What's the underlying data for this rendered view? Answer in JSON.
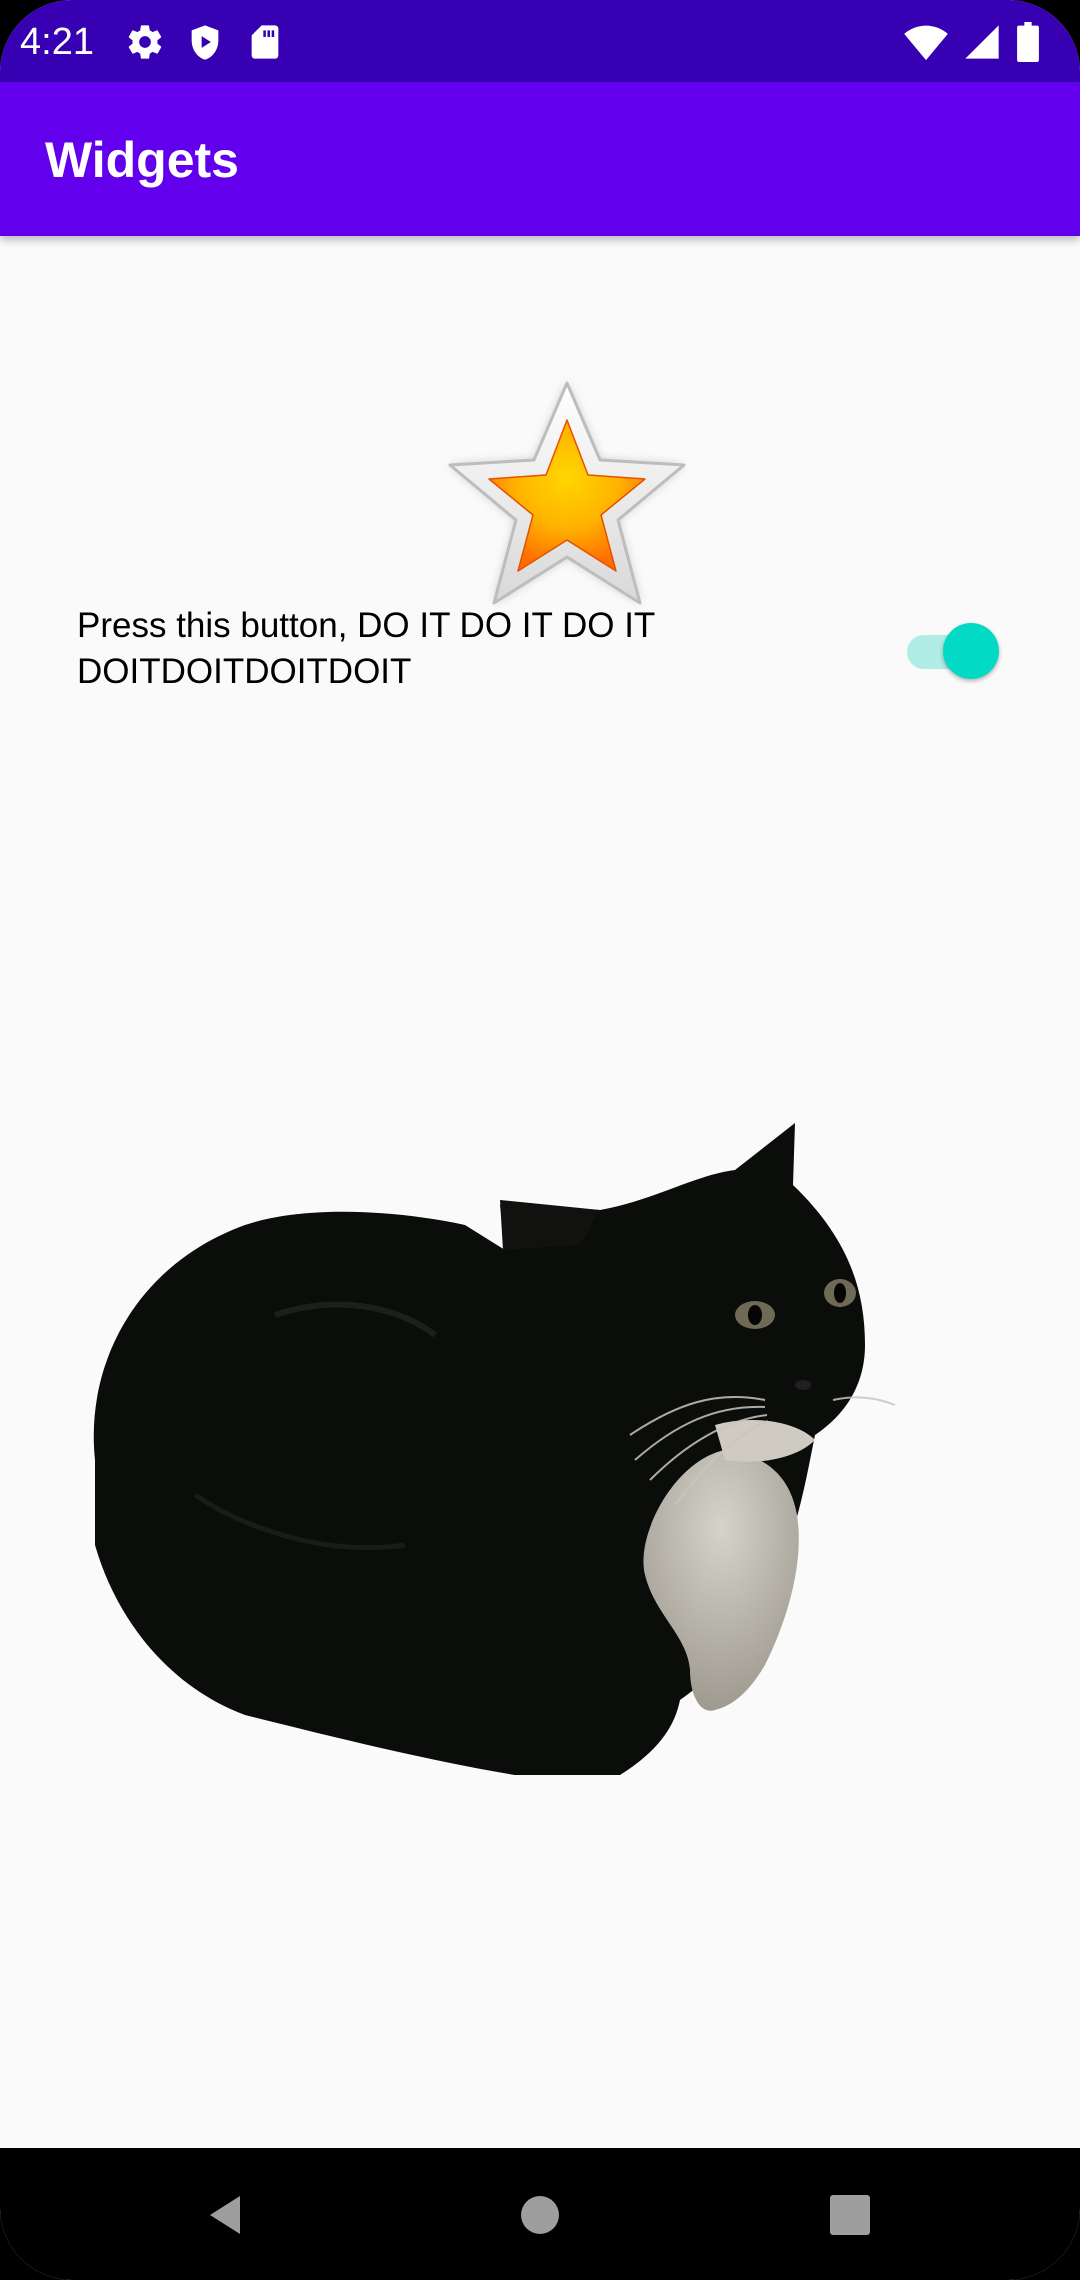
{
  "status_bar": {
    "time": "4:21",
    "color": "#3700b3",
    "icons_left": [
      "settings-icon",
      "play-protect-icon",
      "sd-card-icon"
    ],
    "icons_right": [
      "wifi-icon",
      "signal-icon",
      "battery-icon"
    ]
  },
  "app_bar": {
    "title": "Widgets",
    "color": "#6200ee"
  },
  "star_button": {
    "icon": "star-icon"
  },
  "switch_row": {
    "label": "Press this button, DO IT DO IT DO IT\nDOITDOITDOITDOIT",
    "checked": true,
    "accent": "#03dac5"
  },
  "image": {
    "subject": "cat-image"
  },
  "nav_bar": {
    "buttons": [
      "back-icon",
      "home-icon",
      "recents-icon"
    ]
  }
}
